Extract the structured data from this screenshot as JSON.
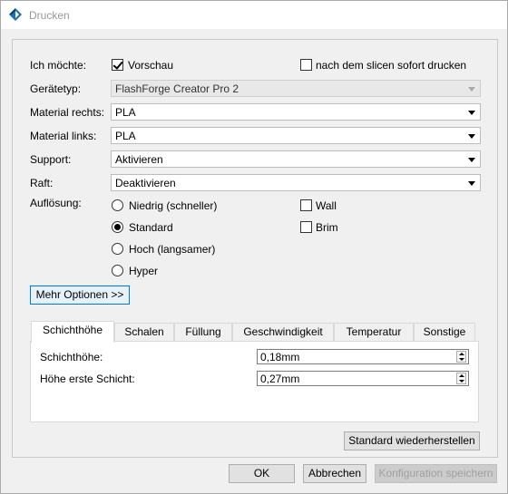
{
  "window": {
    "title": "Drucken"
  },
  "form": {
    "ich_moechte_label": "Ich möchte:",
    "vorschau_label": "Vorschau",
    "sofort_drucken_label": "nach dem slicen sofort drucken",
    "geraetetyp_label": "Gerätetyp:",
    "geraetetyp_value": "FlashForge Creator Pro 2",
    "material_rechts_label": "Material rechts:",
    "material_rechts_value": "PLA",
    "material_links_label": "Material links:",
    "material_links_value": "PLA",
    "support_label": "Support:",
    "support_value": "Aktivieren",
    "raft_label": "Raft:",
    "raft_value": "Deaktivieren",
    "aufloesung_label": "Auflösung:",
    "resolution_options": [
      "Niedrig (schneller)",
      "Standard",
      "Hoch (langsamer)",
      "Hyper"
    ],
    "resolution_selected": "Standard",
    "wall_label": "Wall",
    "brim_label": "Brim",
    "mehr_optionen_label": "Mehr Optionen >>"
  },
  "checks": {
    "vorschau": true,
    "sofort_drucken": false,
    "wall": false,
    "brim": false
  },
  "tabs": {
    "items": [
      "Schichthöhe",
      "Schalen",
      "Füllung",
      "Geschwindigkeit",
      "Temperatur",
      "Sonstige"
    ],
    "active": "Schichthöhe"
  },
  "schichthoehe": {
    "schichthoehe_label": "Schichthöhe:",
    "schichthoehe_value": "0,18mm",
    "erste_schicht_label": "Höhe erste Schicht:",
    "erste_schicht_value": "0,27mm"
  },
  "buttons": {
    "standard_wiederherstellen": "Standard wiederherstellen",
    "ok": "OK",
    "abbrechen": "Abbrechen",
    "konfiguration_speichern": "Konfiguration speichern"
  },
  "colors": {
    "accent": "#0078d7",
    "window_bg": "#f0f0f0",
    "icon_blue": "#1e6fb8"
  }
}
